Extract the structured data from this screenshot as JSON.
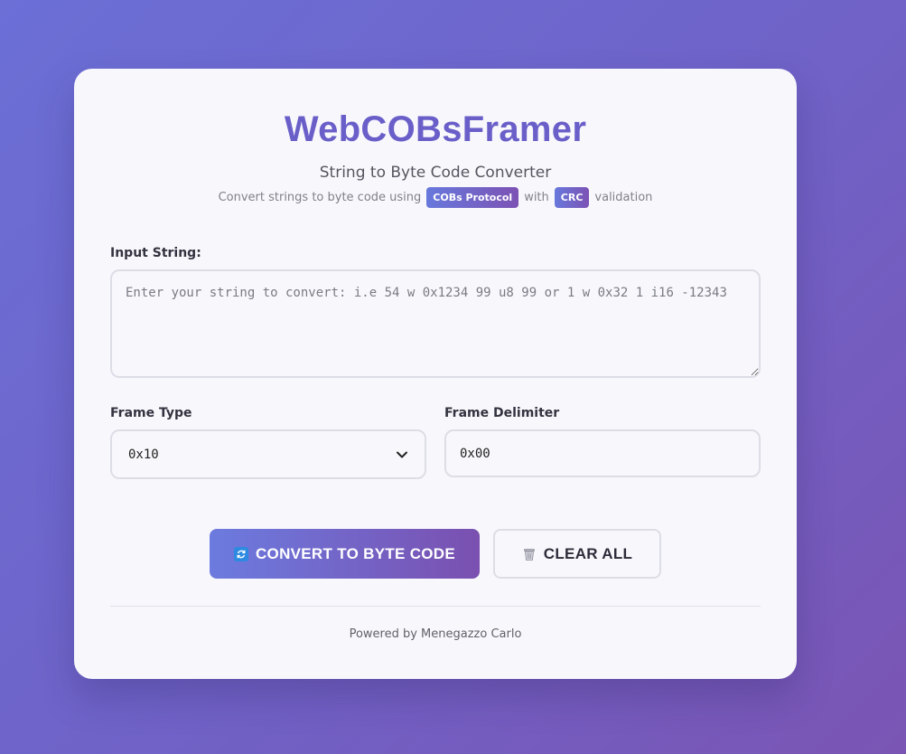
{
  "header": {
    "title": "WebCOBsFramer",
    "subtitle": "String to Byte Code Converter",
    "desc_prefix": "Convert strings to byte code using",
    "badge_cobs": "COBs Protocol",
    "desc_with": "with",
    "badge_crc": "CRC",
    "desc_suffix": "validation"
  },
  "input": {
    "label": "Input String:",
    "value": "",
    "placeholder": "Enter your string to convert: i.e 54 w 0x1234 99 u8 99 or 1 w 0x32 1 i16 -12343"
  },
  "frame_type": {
    "label": "Frame Type",
    "selected": "0x10"
  },
  "frame_delimiter": {
    "label": "Frame Delimiter",
    "value": "0x00"
  },
  "buttons": {
    "convert": "CONVERT TO BYTE CODE",
    "clear": "CLEAR ALL"
  },
  "icons": {
    "convert": "refresh-icon",
    "clear": "trash-icon",
    "select": "chevron-down-icon"
  },
  "colors": {
    "accent": "#6a5fc9",
    "gradient_start": "#6c7bdf",
    "gradient_end": "#7a50b0"
  },
  "footer": {
    "text": "Powered by Menegazzo Carlo"
  }
}
